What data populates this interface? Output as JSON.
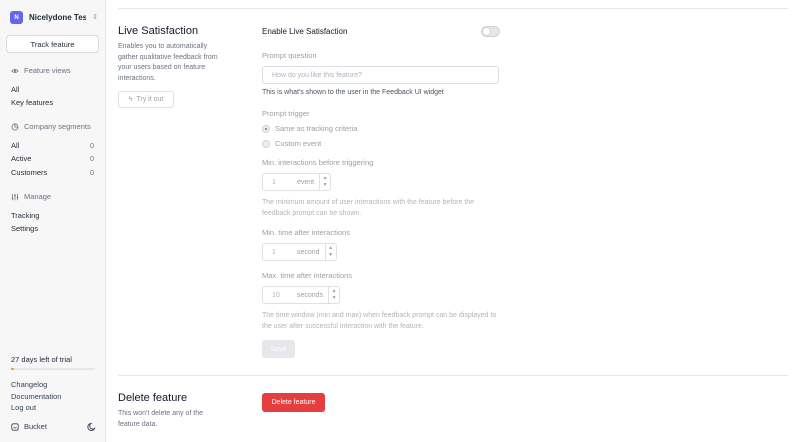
{
  "org": {
    "initial": "N",
    "name": "Nicelydone Tes..."
  },
  "sidebar": {
    "track_feature_label": "Track feature",
    "feature_views": {
      "title": "Feature views",
      "items": [
        {
          "label": "All"
        },
        {
          "label": "Key features"
        }
      ]
    },
    "company_segments": {
      "title": "Company segments",
      "items": [
        {
          "label": "All",
          "count": "0"
        },
        {
          "label": "Active",
          "count": "0"
        },
        {
          "label": "Customers",
          "count": "0"
        }
      ]
    },
    "manage": {
      "title": "Manage",
      "items": [
        {
          "label": "Tracking"
        },
        {
          "label": "Settings"
        }
      ]
    },
    "trial": {
      "text": "27 days left of trial",
      "progress": 0.04,
      "color": "#f59e0b"
    },
    "footer_links": [
      "Changelog",
      "Documentation",
      "Log out"
    ],
    "bucket_label": "Bucket"
  },
  "live_satisfaction": {
    "title": "Live Satisfaction",
    "description": "Enables you to automatically gather qualitative feedback from your users based on feature interactions.",
    "try_it_out_label": "Try it out",
    "enable_label": "Enable Live Satisfaction",
    "enabled": false,
    "prompt_question": {
      "label": "Prompt question",
      "placeholder": "How do you like this feature?",
      "helper": "This is what's shown to the user in the Feedback UI widget"
    },
    "prompt_trigger": {
      "label": "Prompt trigger",
      "options": [
        {
          "label": "Same as tracking criteria",
          "checked": true
        },
        {
          "label": "Custom event",
          "checked": false
        }
      ]
    },
    "min_interactions": {
      "label": "Min. interactions before triggering",
      "value": "1",
      "unit": "event",
      "helper": "The minimum amount of user interactions with the feature before the feedback prompt can be shown."
    },
    "min_time": {
      "label": "Min. time after interactions",
      "value": "1",
      "unit": "second"
    },
    "max_time": {
      "label": "Max. time after interactions",
      "value": "10",
      "unit": "seconds",
      "helper": "The time window (min and max) when feedback prompt can be displayed to the user after successful interaction with the feature."
    },
    "save_label": "Save"
  },
  "delete_feature": {
    "title": "Delete feature",
    "description": "This won't delete any of the feature data.",
    "button_label": "Delete feature",
    "button_color": "#e53e3e"
  }
}
